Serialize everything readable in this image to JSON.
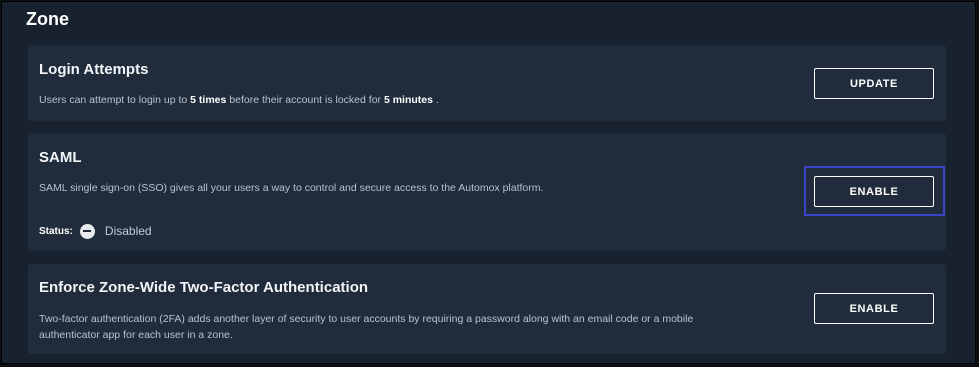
{
  "page": {
    "title": "Zone"
  },
  "login_attempts": {
    "title": "Login Attempts",
    "desc_prefix": "Users can attempt to login up to ",
    "attempts": "5 times",
    "desc_middle": " before their account is locked for ",
    "lock_duration": "5 minutes",
    "desc_suffix": " .",
    "button_label": "UPDATE"
  },
  "saml": {
    "title": "SAML",
    "description": "SAML single sign-on (SSO) gives all your users a way to control and secure access to the Automox platform.",
    "button_label": "ENABLE",
    "status_label": "Status:",
    "status_value": "Disabled",
    "status_icon": "minus-circle-icon"
  },
  "two_factor": {
    "title": "Enforce Zone-Wide Two-Factor Authentication",
    "desc_line1": "Two-factor authentication (2FA) adds another layer of security to user accounts by requiring a password along with an email code or a mobile",
    "desc_line2": "authenticator app for each user in a zone.",
    "button_label": "ENABLE"
  },
  "colors": {
    "background": "#18212e",
    "card": "#202c3c",
    "focus_ring": "#3b44c4",
    "text": "#ffffff"
  }
}
